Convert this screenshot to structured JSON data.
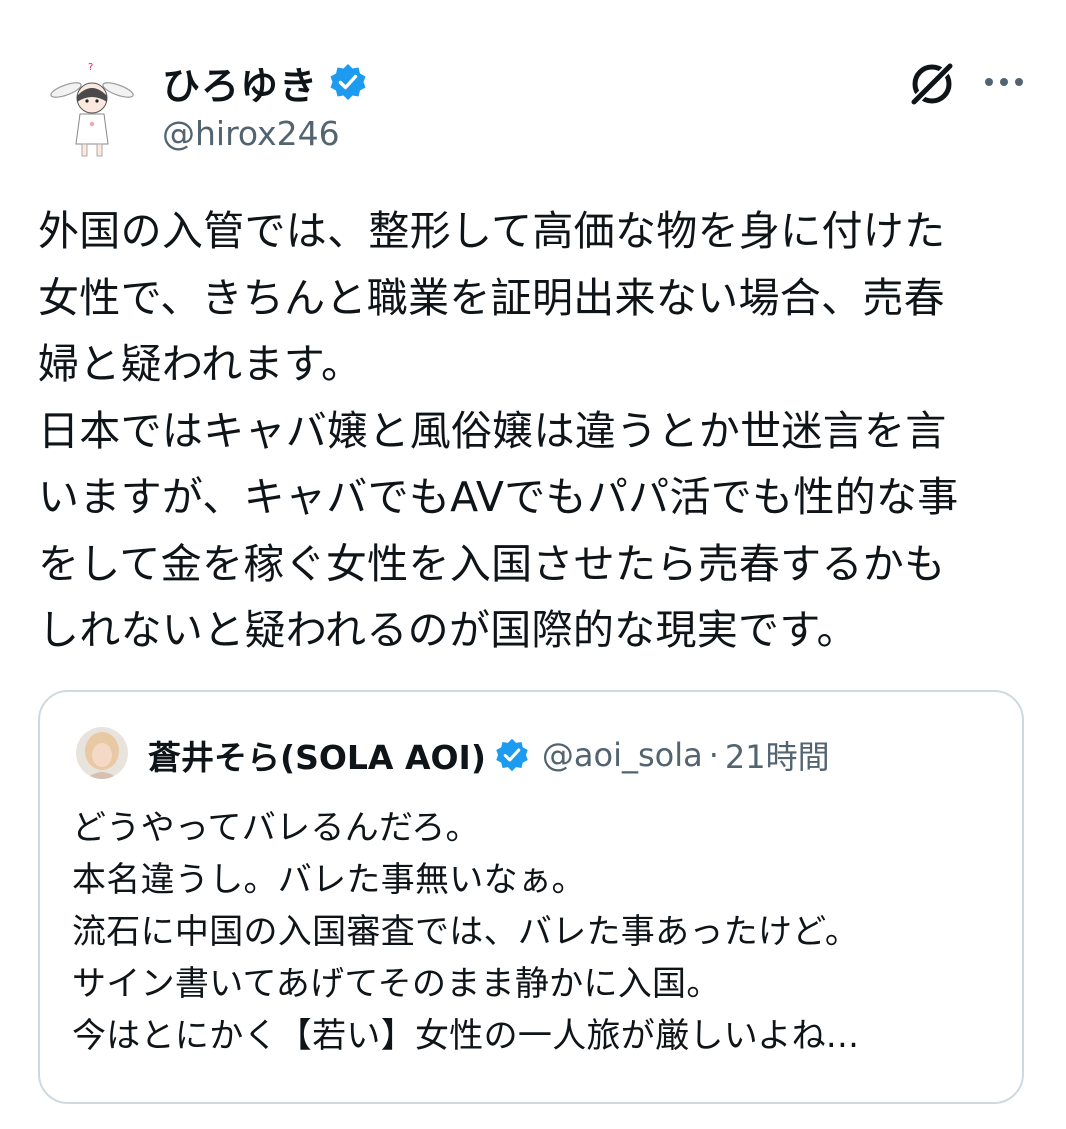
{
  "tweet": {
    "author": {
      "name": "ひろゆき",
      "handle": "@hirox246",
      "avatar_icon": "bunny-ear-character-avatar",
      "verified_icon": "verified-badge-icon"
    },
    "text_lines": [
      "外国の入管では、整形して高価な物を身に付けた",
      "女性で、きちんと職業を証明出来ない場合、売春",
      "婦と疑われます。",
      "日本ではキャバ嬢と風俗嬢は違うとか世迷言を言",
      "いますが、キャバでもAVでもパパ活でも性的な事",
      "をして金を稼ぐ女性を入国させたら売春するかも",
      "しれないと疑われるのが国際的な現実です。"
    ],
    "actions": {
      "grok_icon": "grok-icon",
      "more_icon": "more-options-icon"
    }
  },
  "quote": {
    "author": {
      "name": "蒼井そら(SOLA AOI)",
      "handle": "@aoi_sola",
      "separator": "·",
      "time": "21時間",
      "avatar_icon": "user-photo-avatar",
      "verified_icon": "verified-badge-icon"
    },
    "text_lines": [
      "どうやってバレるんだろ。",
      "本名違うし。バレた事無いなぁ。",
      "流石に中国の入国審査では、バレた事あったけど。",
      "サイン書いてあげてそのまま静かに入国。",
      "今はとにかく【若い】女性の一人旅が厳しいよね..."
    ]
  },
  "colors": {
    "text": "#0f1419",
    "secondary": "#536471",
    "verified": "#1d9bf0",
    "border": "#cfd9de"
  }
}
